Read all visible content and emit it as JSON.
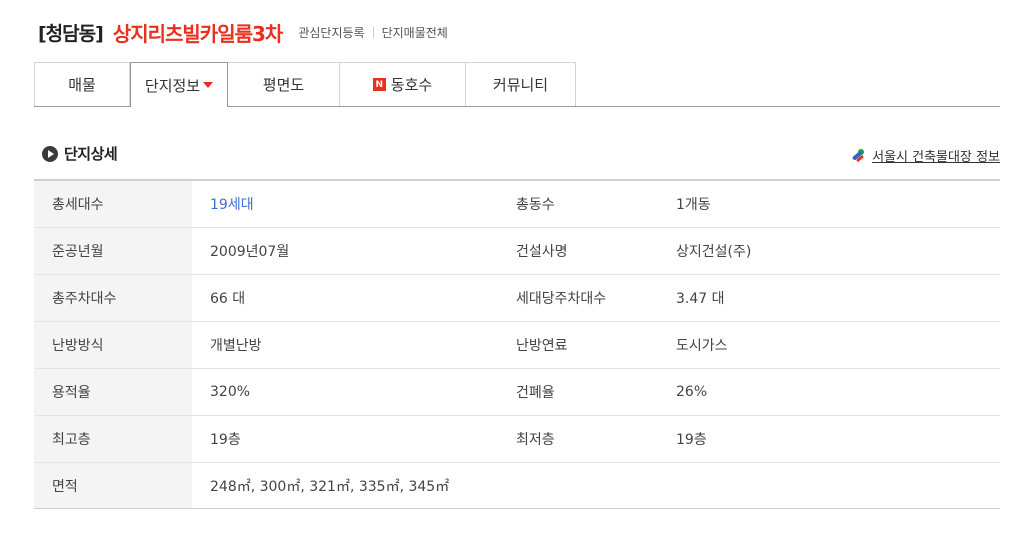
{
  "header": {
    "dong": "[청담동]",
    "complex_name": "상지리츠빌카일룸3차",
    "link_interest": "관심단지등록",
    "link_all_listings": "단지매물전체"
  },
  "tabs": [
    {
      "label": "매물"
    },
    {
      "label": "단지정보",
      "active": true
    },
    {
      "label": "평면도"
    },
    {
      "label": "동호수",
      "badge": "N"
    },
    {
      "label": "커뮤니티"
    }
  ],
  "section": {
    "title": "단지상세",
    "external_link": "서울시 건축물대장 정보"
  },
  "details": {
    "households_label": "총세대수",
    "households_value": "19세대",
    "buildings_label": "총동수",
    "buildings_value": "1개동",
    "completion_label": "준공년월",
    "completion_value": "2009년07월",
    "builder_label": "건설사명",
    "builder_value": "상지건설(주)",
    "parking_label": "총주차대수",
    "parking_value": "66 대",
    "parking_per_label": "세대당주차대수",
    "parking_per_value": "3.47 대",
    "heating_label": "난방방식",
    "heating_value": "개별난방",
    "fuel_label": "난방연료",
    "fuel_value": "도시가스",
    "far_label": "용적율",
    "far_value": "320%",
    "bcr_label": "건폐율",
    "bcr_value": "26%",
    "max_floor_label": "최고층",
    "max_floor_value": "19층",
    "min_floor_label": "최저층",
    "min_floor_value": "19층",
    "area_label": "면적",
    "area_value": "248㎡, 300㎡, 321㎡, 335㎡, 345㎡"
  },
  "colors": {
    "accent_red": "#e8301f",
    "link_blue": "#3b6fd1",
    "label_bg": "#f4f4f4"
  }
}
